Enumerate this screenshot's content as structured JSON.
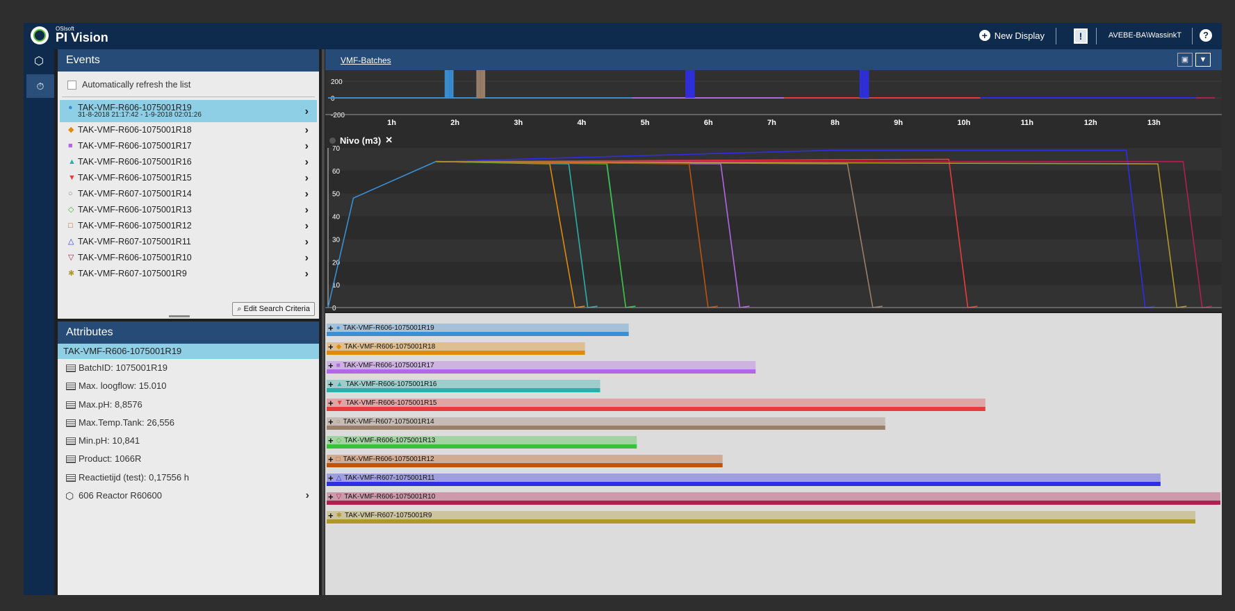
{
  "topbar": {
    "brand_small": "OSIsoft",
    "brand": "PI Vision",
    "new_display": "New Display",
    "alert": "!",
    "user": "AVEBE-BA\\WassinkT",
    "help": "?"
  },
  "events": {
    "header": "Events",
    "auto_refresh": "Automatically refresh the list",
    "edit_search": "Edit Search Criteria",
    "items": [
      {
        "name": "TAK-VMF-R606-1075001R19",
        "sub": "31-8-2018 21:17:42 - 1-9-2018 02:01:26",
        "icon": "●",
        "color": "#3a8fd4",
        "selected": true
      },
      {
        "name": "TAK-VMF-R606-1075001R18",
        "icon": "◆",
        "color": "#e08a0a"
      },
      {
        "name": "TAK-VMF-R606-1075001R17",
        "icon": "■",
        "color": "#b366e6"
      },
      {
        "name": "TAK-VMF-R606-1075001R16",
        "icon": "▲",
        "color": "#2ab0aa"
      },
      {
        "name": "TAK-VMF-R606-1075001R15",
        "icon": "▼",
        "color": "#e63c3c"
      },
      {
        "name": "TAK-VMF-R607-1075001R14",
        "icon": "○",
        "color": "#9a7f6a"
      },
      {
        "name": "TAK-VMF-R606-1075001R13",
        "icon": "◇",
        "color": "#38c238"
      },
      {
        "name": "TAK-VMF-R606-1075001R12",
        "icon": "□",
        "color": "#c0530a"
      },
      {
        "name": "TAK-VMF-R607-1075001R11",
        "icon": "△",
        "color": "#2e2ee6"
      },
      {
        "name": "TAK-VMF-R606-1075001R10",
        "icon": "▽",
        "color": "#b02050"
      },
      {
        "name": "TAK-VMF-R607-1075001R9",
        "icon": "✱",
        "color": "#b0972a"
      }
    ]
  },
  "attributes": {
    "header": "Attributes",
    "selected": "TAK-VMF-R606-1075001R19",
    "items": [
      "BatchID: 1075001R19",
      "Max. loogflow: 15.010",
      "Max.pH: 8,8576",
      "Max.Temp.Tank: 26,556",
      "Min.pH: 10,841",
      "Product: 1066R",
      "Reactietijd (test): 0,17556 h"
    ],
    "asset": "606 Reactor R60600"
  },
  "main": {
    "page_link": "VMF-Batches",
    "trend_title": "Nivo (m3)",
    "close": "✕"
  },
  "chart_data": [
    {
      "type": "line",
      "x_unit": "h",
      "x": [
        "1h",
        "2h",
        "3h",
        "4h",
        "5h",
        "6h",
        "7h",
        "8h",
        "9h",
        "10h",
        "11h",
        "12h",
        "13h"
      ],
      "ylim": [
        -200,
        200
      ],
      "y_ticks": [
        "200",
        "0",
        "-200"
      ]
    },
    {
      "type": "line",
      "title": "Nivo (m3)",
      "x": [
        "1h",
        "2h",
        "3h",
        "4h",
        "5h",
        "6h",
        "7h",
        "8h",
        "9h",
        "10h",
        "11h",
        "12h",
        "13h"
      ],
      "ylim": [
        0,
        70
      ],
      "y_ticks": [
        "70",
        "60",
        "50",
        "40",
        "30",
        "20",
        "10",
        "0"
      ],
      "series": [
        {
          "color": "#3a8fd4",
          "points": [
            [
              0,
              0
            ],
            [
              0.4,
              48
            ],
            [
              1.7,
              64
            ],
            [
              4.4,
              64
            ],
            [
              4.7,
              0
            ]
          ]
        },
        {
          "color": "#e08a0a",
          "points": [
            [
              1.7,
              64
            ],
            [
              3.5,
              63
            ],
            [
              3.9,
              0
            ]
          ]
        },
        {
          "color": "#b366e6",
          "points": [
            [
              1.7,
              64
            ],
            [
              6.2,
              63
            ],
            [
              6.5,
              0
            ]
          ]
        },
        {
          "color": "#2ab0aa",
          "points": [
            [
              1.7,
              64
            ],
            [
              3.8,
              63
            ],
            [
              4.1,
              0
            ]
          ]
        },
        {
          "color": "#e63c3c",
          "points": [
            [
              1.7,
              64
            ],
            [
              9.8,
              65
            ],
            [
              10.1,
              0
            ]
          ]
        },
        {
          "color": "#9a7f6a",
          "points": [
            [
              1.7,
              64
            ],
            [
              8.2,
              63
            ],
            [
              8.6,
              0
            ]
          ]
        },
        {
          "color": "#38c238",
          "points": [
            [
              1.7,
              64
            ],
            [
              4.4,
              63
            ],
            [
              4.7,
              0
            ]
          ]
        },
        {
          "color": "#c0530a",
          "points": [
            [
              1.7,
              64
            ],
            [
              5.7,
              63
            ],
            [
              6.0,
              0
            ]
          ]
        },
        {
          "color": "#2e2ee6",
          "points": [
            [
              1.7,
              64
            ],
            [
              8.0,
              69
            ],
            [
              12.6,
              69
            ],
            [
              12.9,
              0
            ]
          ]
        },
        {
          "color": "#b02050",
          "points": [
            [
              1.7,
              64
            ],
            [
              13.5,
              64
            ],
            [
              13.8,
              0
            ]
          ]
        },
        {
          "color": "#b0972a",
          "points": [
            [
              1.7,
              64
            ],
            [
              13.1,
              63
            ],
            [
              13.4,
              0
            ]
          ]
        }
      ]
    }
  ],
  "gantt": {
    "fractions": [
      0.338,
      0.289,
      0.48,
      0.306,
      0.737,
      0.625,
      0.347,
      0.443,
      0.933,
      1.0,
      0.972
    ]
  }
}
